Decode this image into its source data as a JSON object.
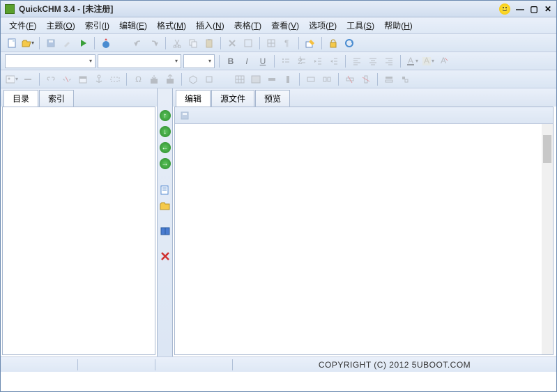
{
  "title": "QuickCHM 3.4 - [未注册]",
  "menu": [
    {
      "label": "文件",
      "key": "F"
    },
    {
      "label": "主题",
      "key": "O"
    },
    {
      "label": "索引",
      "key": "I"
    },
    {
      "label": "编辑",
      "key": "E"
    },
    {
      "label": "格式",
      "key": "M"
    },
    {
      "label": "插入",
      "key": "N"
    },
    {
      "label": "表格",
      "key": "T"
    },
    {
      "label": "查看",
      "key": "V"
    },
    {
      "label": "选项",
      "key": "P"
    },
    {
      "label": "工具",
      "key": "S"
    },
    {
      "label": "帮助",
      "key": "H"
    }
  ],
  "left_tabs": [
    "目录",
    "索引"
  ],
  "right_tabs": [
    "编辑",
    "源文件",
    "预览"
  ],
  "statusbar": {
    "copyright": "COPYRIGHT (C) 2012 5UBOOT.COM"
  },
  "font_combo": {
    "name": "",
    "style": "",
    "size": ""
  }
}
